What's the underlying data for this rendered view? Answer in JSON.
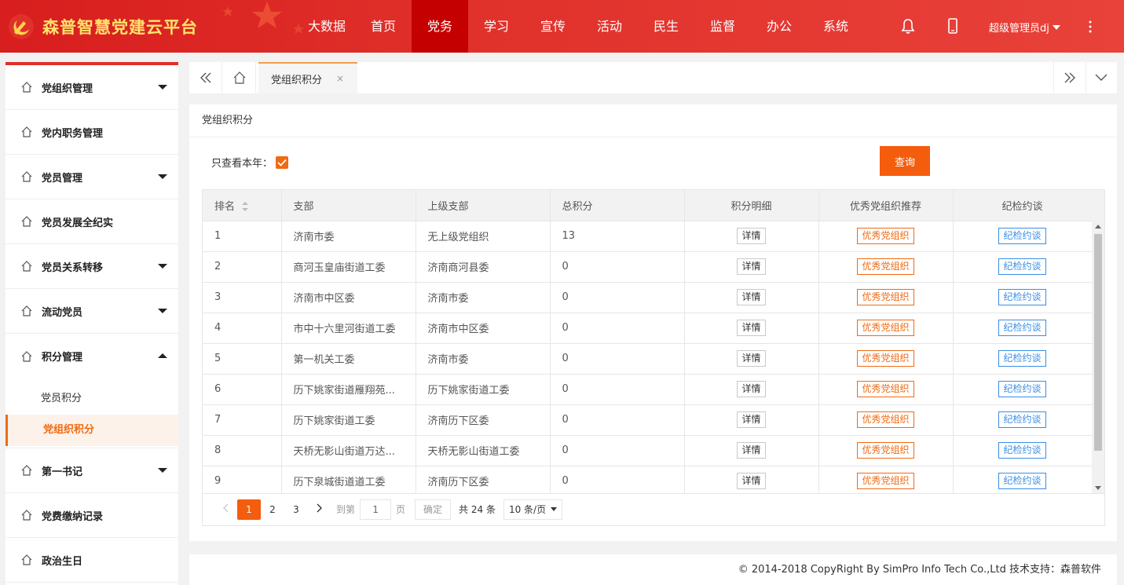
{
  "header": {
    "logo_text": "森普智慧党建云平台",
    "nav": [
      "大数据",
      "首页",
      "党务",
      "学习",
      "宣传",
      "活动",
      "民生",
      "监督",
      "办公",
      "系统"
    ],
    "active_nav": "党务",
    "user": "超级管理员dj"
  },
  "sidebar": {
    "items": [
      {
        "label": "党组织管理",
        "arrow": "down"
      },
      {
        "label": "党内职务管理",
        "arrow": ""
      },
      {
        "label": "党员管理",
        "arrow": "down"
      },
      {
        "label": "党员发展全纪实",
        "arrow": ""
      },
      {
        "label": "党员关系转移",
        "arrow": "down"
      },
      {
        "label": "流动党员",
        "arrow": "down"
      },
      {
        "label": "积分管理",
        "arrow": "up"
      },
      {
        "label": "第一书记",
        "arrow": "down"
      },
      {
        "label": "党费缴纳记录",
        "arrow": ""
      },
      {
        "label": "政治生日",
        "arrow": ""
      }
    ],
    "sub_items": [
      "党员积分",
      "党组织积分"
    ],
    "active_sub": "党组织积分"
  },
  "tabbar": {
    "tab_label": "党组织积分",
    "close": "×"
  },
  "panel": {
    "title": "党组织积分",
    "filter_label": "只查看本年：",
    "query_label": "查询"
  },
  "table": {
    "headers": [
      "排名",
      "支部",
      "上级支部",
      "总积分",
      "积分明细",
      "优秀党组织推荐",
      "纪检约谈"
    ],
    "detail_label": "详情",
    "excellent_label": "优秀党组织",
    "talk_label": "纪检约谈",
    "rows": [
      {
        "rank": "1",
        "branch": "济南市委",
        "parent": "无上级党组织",
        "score": "13"
      },
      {
        "rank": "2",
        "branch": "商河玉皇庙街道工委",
        "parent": "济南商河县委",
        "score": "0"
      },
      {
        "rank": "3",
        "branch": "济南市中区委",
        "parent": "济南市委",
        "score": "0"
      },
      {
        "rank": "4",
        "branch": "市中十六里河街道工委",
        "parent": "济南市中区委",
        "score": "0"
      },
      {
        "rank": "5",
        "branch": "第一机关工委",
        "parent": "济南市委",
        "score": "0"
      },
      {
        "rank": "6",
        "branch": "历下姚家街道雁翔苑...",
        "parent": "历下姚家街道工委",
        "score": "0"
      },
      {
        "rank": "7",
        "branch": "历下姚家街道工委",
        "parent": "济南历下区委",
        "score": "0"
      },
      {
        "rank": "8",
        "branch": "天桥无影山街道万达...",
        "parent": "天桥无影山街道工委",
        "score": "0"
      },
      {
        "rank": "9",
        "branch": "历下泉城街道道工委",
        "parent": "济南历下区委",
        "score": "0"
      }
    ]
  },
  "pager": {
    "pages": [
      "1",
      "2",
      "3"
    ],
    "goto_label": "到第",
    "page_value": "1",
    "page_unit": "页",
    "confirm": "确定",
    "total": "共 24 条",
    "page_size": "10 条/页"
  },
  "footer": {
    "text": "© 2014-2018 CopyRight By SimPro Info Tech Co.,Ltd 技术支持：森普软件"
  },
  "colors": {
    "header_red": "#e0302a",
    "active_nav": "#c40000",
    "accent_orange": "#f45d0d",
    "talk_blue": "#3a8ee6"
  }
}
